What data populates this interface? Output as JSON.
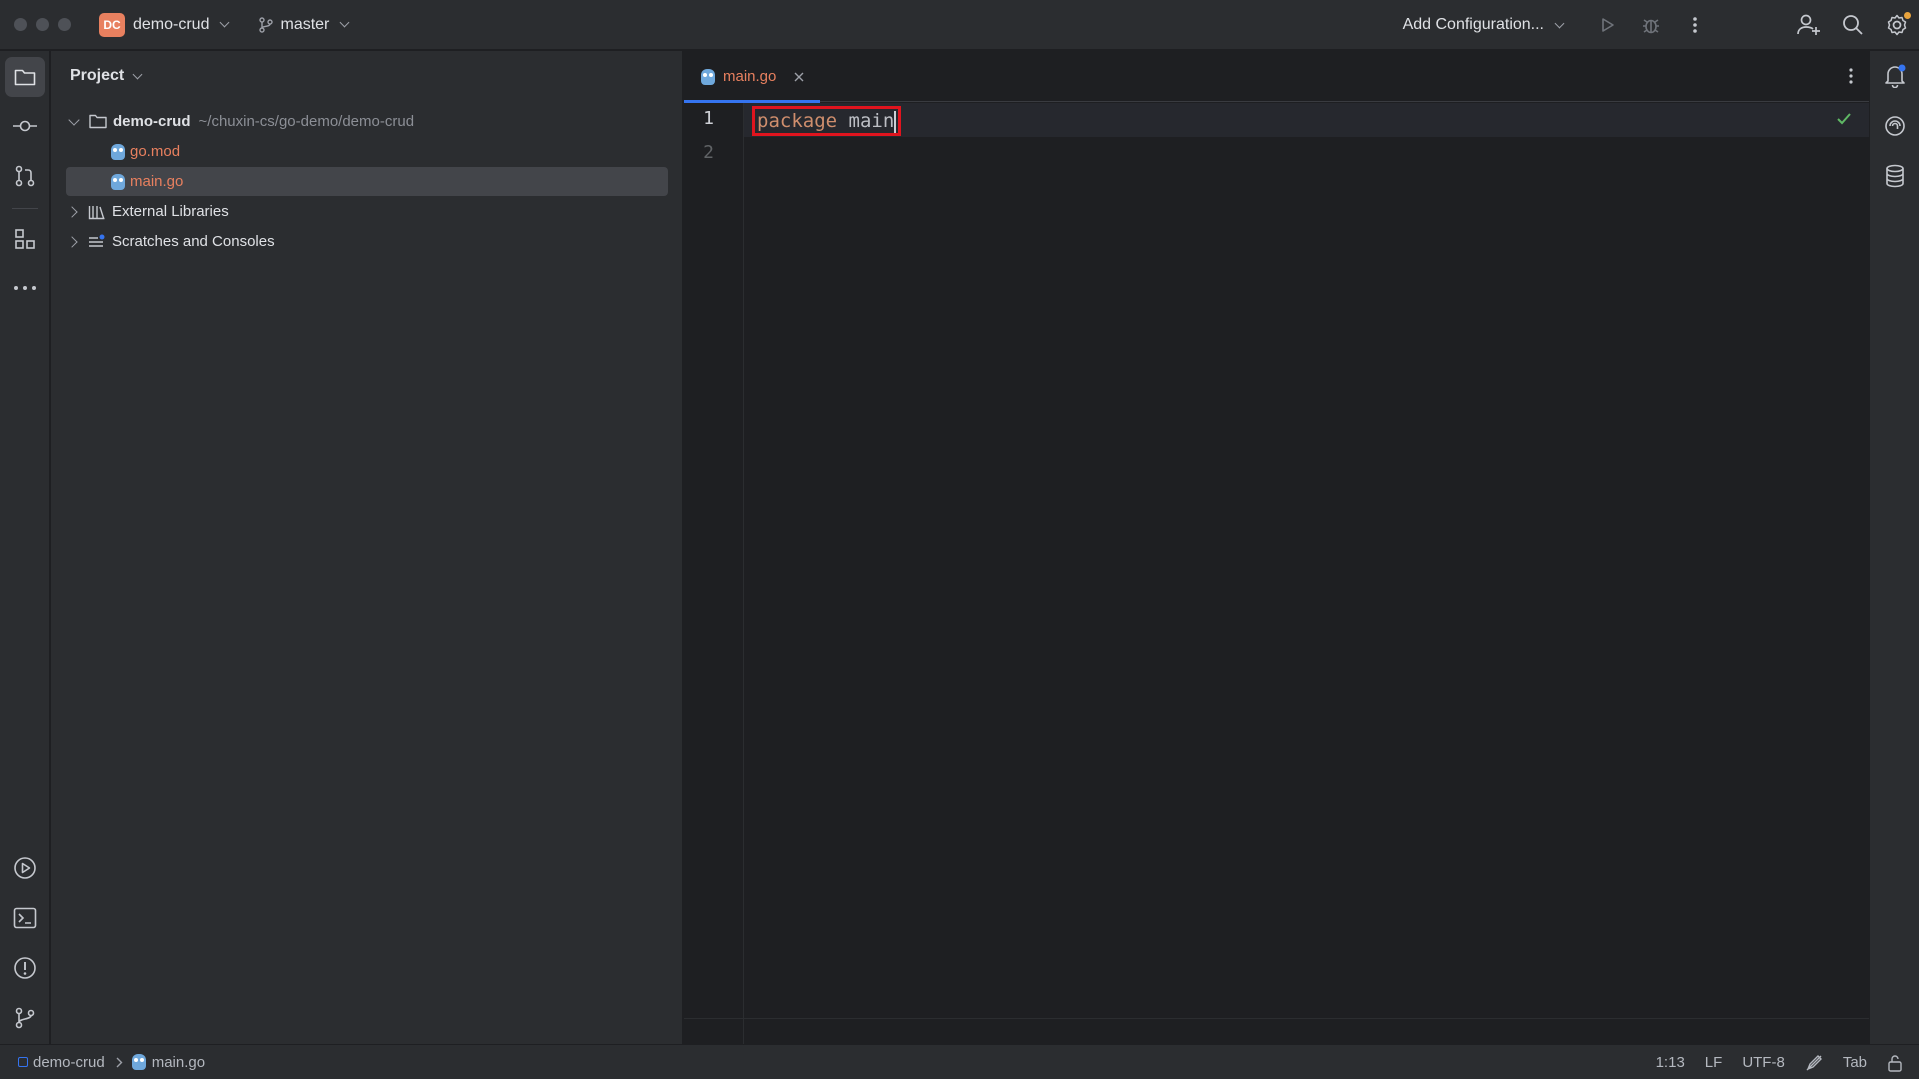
{
  "titlebar": {
    "project_badge": "DC",
    "project_name": "demo-crud",
    "branch": "master",
    "run_config": "Add Configuration..."
  },
  "project_panel": {
    "title": "Project",
    "tree": [
      {
        "label": "demo-crud",
        "path": "~/chuxin-cs/go-demo/demo-crud"
      },
      {
        "label": "go.mod"
      },
      {
        "label": "main.go"
      },
      {
        "label": "External Libraries"
      },
      {
        "label": "Scratches and Consoles"
      }
    ]
  },
  "editor": {
    "tab": {
      "label": "main.go"
    },
    "line_numbers": [
      "1",
      "2"
    ],
    "code": {
      "keyword": "package",
      "identifier": "main"
    }
  },
  "statusbar": {
    "breadcrumb_project": "demo-crud",
    "breadcrumb_file": "main.go",
    "caret_position": "1:13",
    "line_separator": "LF",
    "encoding": "UTF-8",
    "indent": "Tab"
  },
  "colors": {
    "accent": "#3574f0",
    "project_badge": "#e8805f",
    "highlight_box": "#e0141e",
    "keyword": "#cf8e6d",
    "modified_file": "#e8805f",
    "ok_check": "#5fb865"
  },
  "icons": {
    "left_strip_top": [
      "folder-icon",
      "commit-icon",
      "pull-request-icon",
      "structure-icon",
      "more-icon"
    ],
    "left_strip_bottom": [
      "run-icon",
      "terminal-icon",
      "problems-icon",
      "git-icon"
    ],
    "right_strip": [
      "notifications-icon",
      "ai-assistant-icon",
      "database-icon"
    ],
    "titlebar_right": [
      "run-icon",
      "debug-icon",
      "more-vertical-icon",
      "add-user-icon",
      "search-icon",
      "settings-icon"
    ]
  }
}
